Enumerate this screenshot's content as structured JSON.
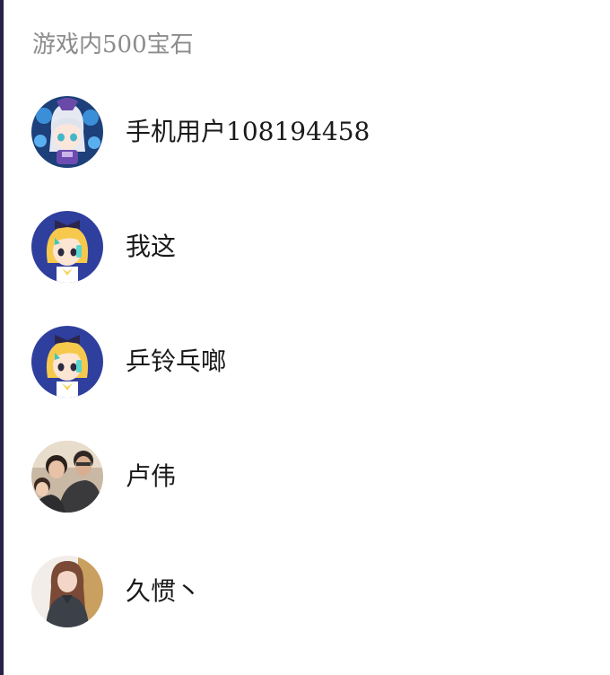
{
  "header": {
    "title": "游戏内500宝石"
  },
  "users": [
    {
      "name": "手机用户108194458",
      "avatar": "anime-silver-hair-avatar-icon"
    },
    {
      "name": "我这",
      "avatar": "anime-blonde-girl-avatar-icon"
    },
    {
      "name": "乒铃乓啷",
      "avatar": "anime-blonde-girl-avatar-icon"
    },
    {
      "name": "卢伟",
      "avatar": "family-photo-avatar-icon"
    },
    {
      "name": "久惯丶",
      "avatar": "woman-photo-avatar-icon"
    }
  ]
}
